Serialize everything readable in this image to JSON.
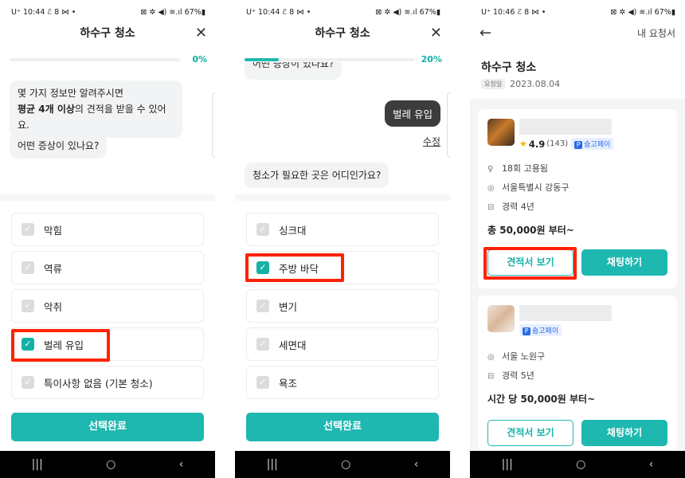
{
  "statusbar": {
    "p1": {
      "left": "U⁺ 10:44 ℰ 8 ⋈ •",
      "right": "⊠ ✲ ◀) ≋.ıl 67%▮"
    },
    "p2": {
      "left": "U⁺ 10:44 ℰ 8 ⋈ •",
      "right": "⊠ ✲ ◀) ≋.ıl 67%▮"
    },
    "p3": {
      "left": "U⁺ 10:46 ℰ 8 ⋈ •",
      "right": "⊠ ✲ ◀) ≋.ıl 67%▮"
    }
  },
  "panel1": {
    "title": "하수구 청소",
    "progress_pct": "0%",
    "progress_value": 0,
    "intro_line1": "몇 가지 정보만 알려주시면",
    "intro_bold": "평균 4개 이상",
    "intro_line2_rest": "의 견적을 받을 수 있어요.",
    "question": "어떤 증상이 있나요?",
    "options": [
      {
        "label": "막힘",
        "checked": false
      },
      {
        "label": "역류",
        "checked": false
      },
      {
        "label": "악취",
        "checked": false
      },
      {
        "label": "벌레 유입",
        "checked": true
      },
      {
        "label": "특이사항 없음 (기본 청소)",
        "checked": false
      }
    ],
    "submit_label": "선택완료"
  },
  "panel2": {
    "title": "하수구 청소",
    "progress_pct": "20%",
    "progress_value": 0.2,
    "cut_question": "어떤 증상이 있나요?",
    "answer": "벌레 유입",
    "edit_label": "수정",
    "question": "청소가 필요한 곳은 어디인가요?",
    "options": [
      {
        "label": "싱크대",
        "checked": false
      },
      {
        "label": "주방 바닥",
        "checked": true
      },
      {
        "label": "변기",
        "checked": false
      },
      {
        "label": "세면대",
        "checked": false
      },
      {
        "label": "욕조",
        "checked": false
      }
    ],
    "submit_label": "선택완료"
  },
  "panel3": {
    "back_icon": "←",
    "my_request": "내 요청서",
    "title": "하수구 청소",
    "request_tag": "요청일",
    "request_date": "2023.08.04",
    "cards": [
      {
        "rating": "4.9",
        "rating_count": "(143)",
        "badge": "숨고페이",
        "info": [
          {
            "icon": "trophy-icon",
            "glyph": "♀",
            "text": "18회 고용됨"
          },
          {
            "icon": "location-icon",
            "glyph": "◎",
            "text": "서울특별시 강동구"
          },
          {
            "icon": "briefcase-icon",
            "glyph": "⊟",
            "text": "경력 4년"
          }
        ],
        "price": "총 50,000원 부터~",
        "quote_btn": "견적서 보기",
        "chat_btn": "채팅하기"
      },
      {
        "badge": "숨고페이",
        "info": [
          {
            "icon": "location-icon",
            "glyph": "◎",
            "text": "서울 노원구"
          },
          {
            "icon": "briefcase-icon",
            "glyph": "⊟",
            "text": "경력 5년"
          }
        ],
        "price": "시간 당 50,000원 부터~",
        "quote_btn": "견적서 보기",
        "chat_btn": "채팅하기"
      }
    ]
  },
  "navbar": {
    "recent": "|||",
    "home": "○",
    "back": "‹"
  },
  "icons": {
    "close": "✕",
    "check": "✓",
    "star": "★",
    "pay_mark": "P"
  },
  "colors": {
    "accent": "#1eb8b0",
    "highlight": "#ff2200",
    "dark_bubble": "#3c3c3c"
  }
}
